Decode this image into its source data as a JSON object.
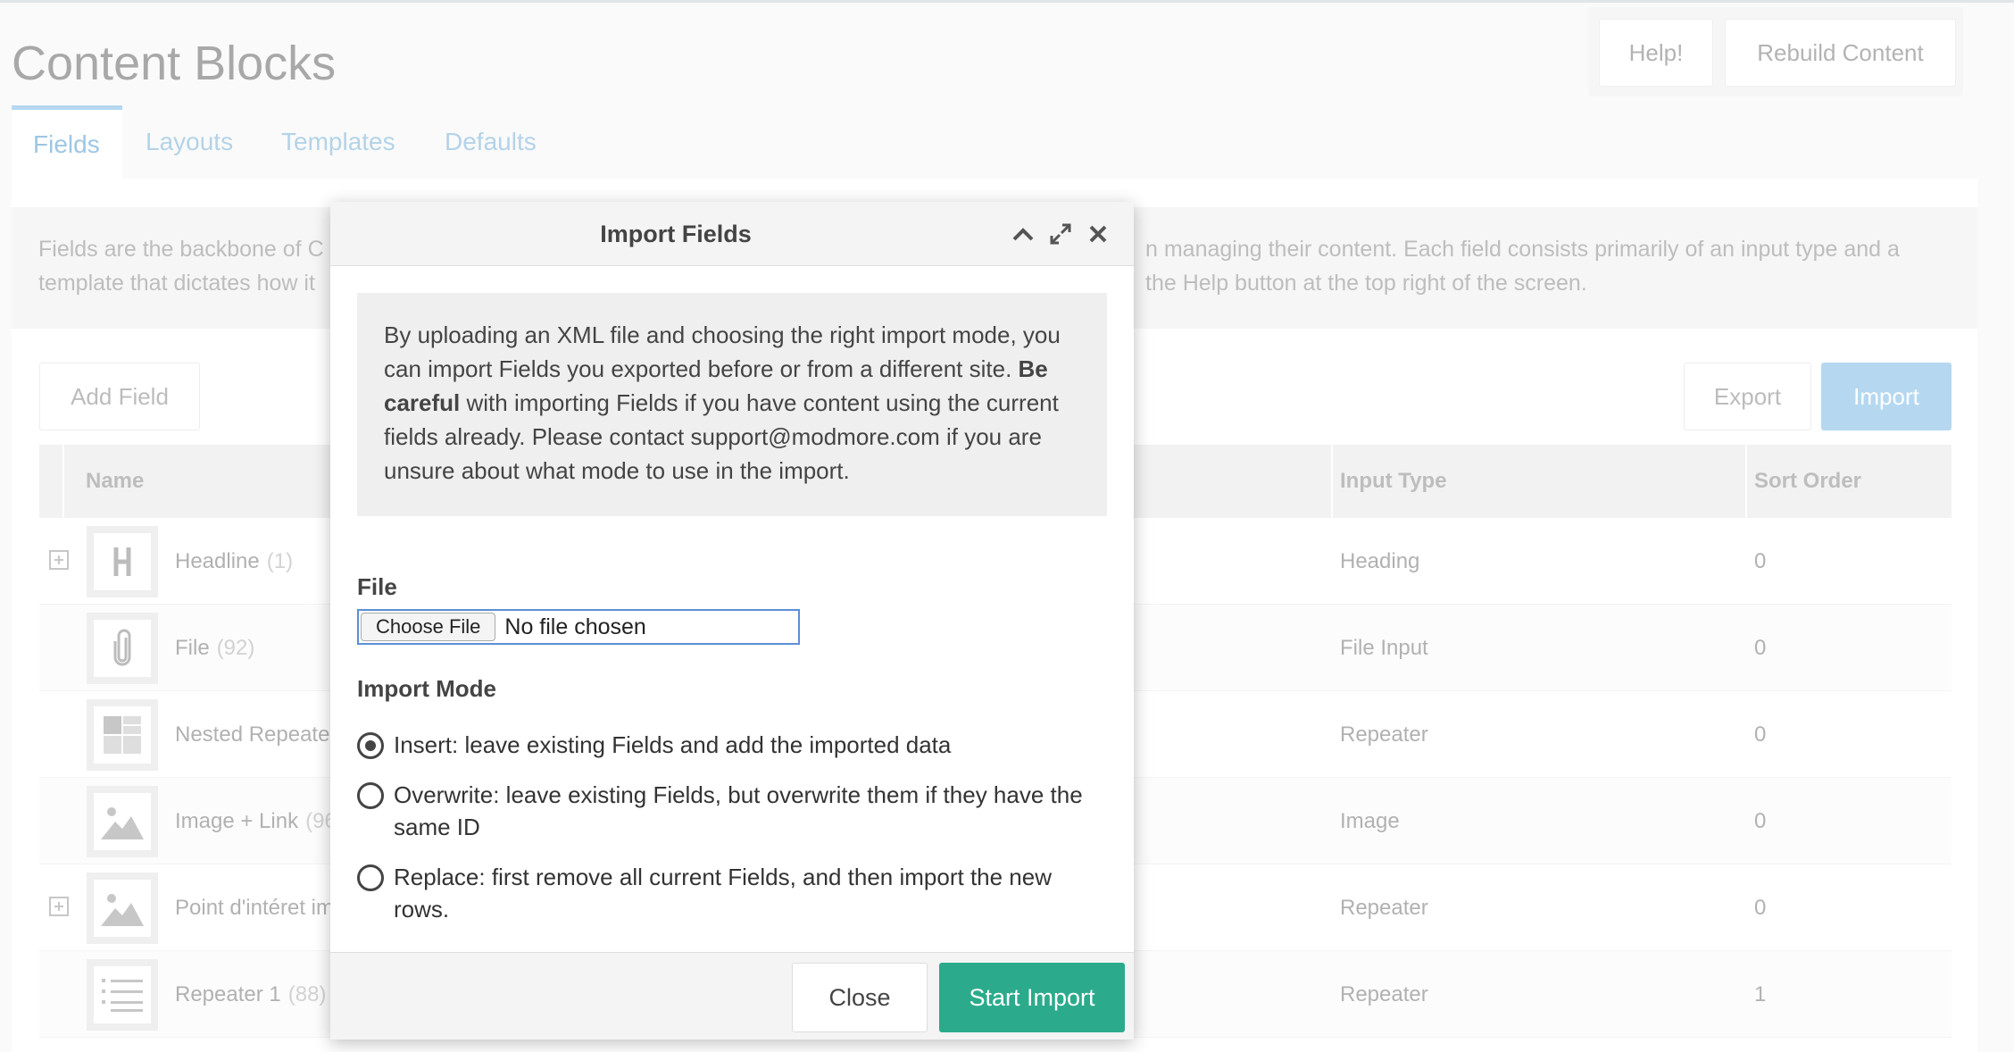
{
  "page": {
    "title": "Content Blocks",
    "help_label": "Help!",
    "rebuild_label": "Rebuild Content"
  },
  "tabs": [
    {
      "label": "Fields",
      "active": true
    },
    {
      "label": "Layouts"
    },
    {
      "label": "Templates"
    },
    {
      "label": "Defaults"
    }
  ],
  "description": {
    "left_line1": "Fields are the backbone of C",
    "left_line2": "template that dictates how it",
    "right_line1": "n managing their content. Each field consists primarily of an input type and a",
    "right_line2": "the Help button at the top right of the screen."
  },
  "toolbar": {
    "add_field": "Add Field",
    "export": "Export",
    "import": "Import"
  },
  "table": {
    "headers": {
      "name": "Name",
      "input_type": "Input Type",
      "sort_order": "Sort Order"
    },
    "rows": [
      {
        "name": "Headline",
        "count": "(1)",
        "input_type": "Heading",
        "sort": "0",
        "icon": "heading-icon",
        "expandable": true
      },
      {
        "name": "File",
        "count": "(92)",
        "input_type": "File Input",
        "sort": "0",
        "icon": "paperclip-icon",
        "expandable": false
      },
      {
        "name": "Nested Repeate",
        "count": "",
        "input_type": "Repeater",
        "sort": "0",
        "icon": "grid-icon",
        "expandable": false
      },
      {
        "name": "Image + Link",
        "count": "(96",
        "input_type": "Image",
        "sort": "0",
        "icon": "image-icon",
        "expandable": false
      },
      {
        "name": "Point d'intéret im",
        "count": "",
        "input_type": "Repeater",
        "sort": "0",
        "icon": "image-icon",
        "expandable": true
      },
      {
        "name": "Repeater 1",
        "count": "(88)",
        "input_type": "Repeater",
        "sort": "1",
        "icon": "list-icon",
        "expandable": false
      }
    ]
  },
  "modal": {
    "title": "Import Fields",
    "info_part1": "By uploading an XML file and choosing the right import mode, you can import Fields you exported before or from a different site. ",
    "info_bold": "Be careful",
    "info_part2": " with importing Fields if you have content using the current fields already. Please contact support@modmore.com if you are unsure about what mode to use in the import.",
    "file_label": "File",
    "choose_file": "Choose File",
    "no_file": "No file chosen",
    "mode_label": "Import Mode",
    "modes": [
      {
        "label": "Insert: leave existing Fields and add the imported data",
        "checked": true
      },
      {
        "label": "Overwrite: leave existing Fields, but overwrite them if they have the same ID",
        "checked": false
      },
      {
        "label": "Replace: first remove all current Fields, and then import the new rows.",
        "checked": false
      }
    ],
    "close_label": "Close",
    "start_label": "Start Import"
  }
}
